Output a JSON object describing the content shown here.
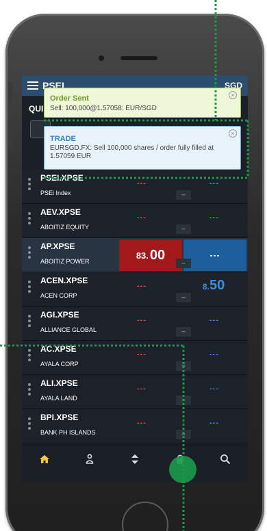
{
  "topbar": {
    "title": "PSEI",
    "right": "SGD"
  },
  "quick_access": {
    "label": "QUI"
  },
  "notifications": [
    {
      "title": "Order Sent",
      "message": "Sell: 100,000@1.57058: EUR/SGD"
    },
    {
      "title": "TRADE",
      "message": "EURSGD.FX: Sell 100,000 shares / order fully filled at 1.57059 EUR"
    }
  ],
  "rows": [
    {
      "symbol": "PSEI.XPSE",
      "name": "PSEi Index",
      "bid": "---",
      "ask": "---",
      "mini": "--"
    },
    {
      "symbol": "AEV.XPSE",
      "name": "ABOITIZ EQUITY",
      "bid": "---",
      "ask": "---",
      "mini": "--"
    },
    {
      "symbol": "AP.XPSE",
      "name": "ABOITIZ POWER",
      "bid_a": "83.",
      "bid_b": "00",
      "ask": "---",
      "mini": "--"
    },
    {
      "symbol": "ACEN.XPSE",
      "name": "ACEN CORP",
      "bid": "---",
      "ask_a": "8.",
      "ask_b": "50",
      "mini": "--"
    },
    {
      "symbol": "AGI.XPSE",
      "name": "ALLIANCE GLOBAL",
      "bid": "---",
      "ask": "---",
      "mini": "--"
    },
    {
      "symbol": "AC.XPSE",
      "name": "AYALA CORP",
      "bid": "---",
      "ask": "---",
      "mini": "--"
    },
    {
      "symbol": "ALI.XPSE",
      "name": "AYALA LAND",
      "bid": "---",
      "ask": "---",
      "mini": "--"
    },
    {
      "symbol": "BPI.XPSE",
      "name": "BANK PH ISLANDS",
      "bid": "---",
      "ask": "---",
      "mini": "--"
    }
  ],
  "tabs": [
    "home-icon",
    "person-icon",
    "sort-icon",
    "lock-icon",
    "search-icon"
  ],
  "colors": {
    "bid_red": "#e84a4a",
    "ask_blue": "#3b8ee6",
    "selected_bid_bg": "#a3191b",
    "selected_ask_bg": "#1b5e9b",
    "guide_green": "#1b9a4a",
    "home_active": "#f5c542"
  }
}
